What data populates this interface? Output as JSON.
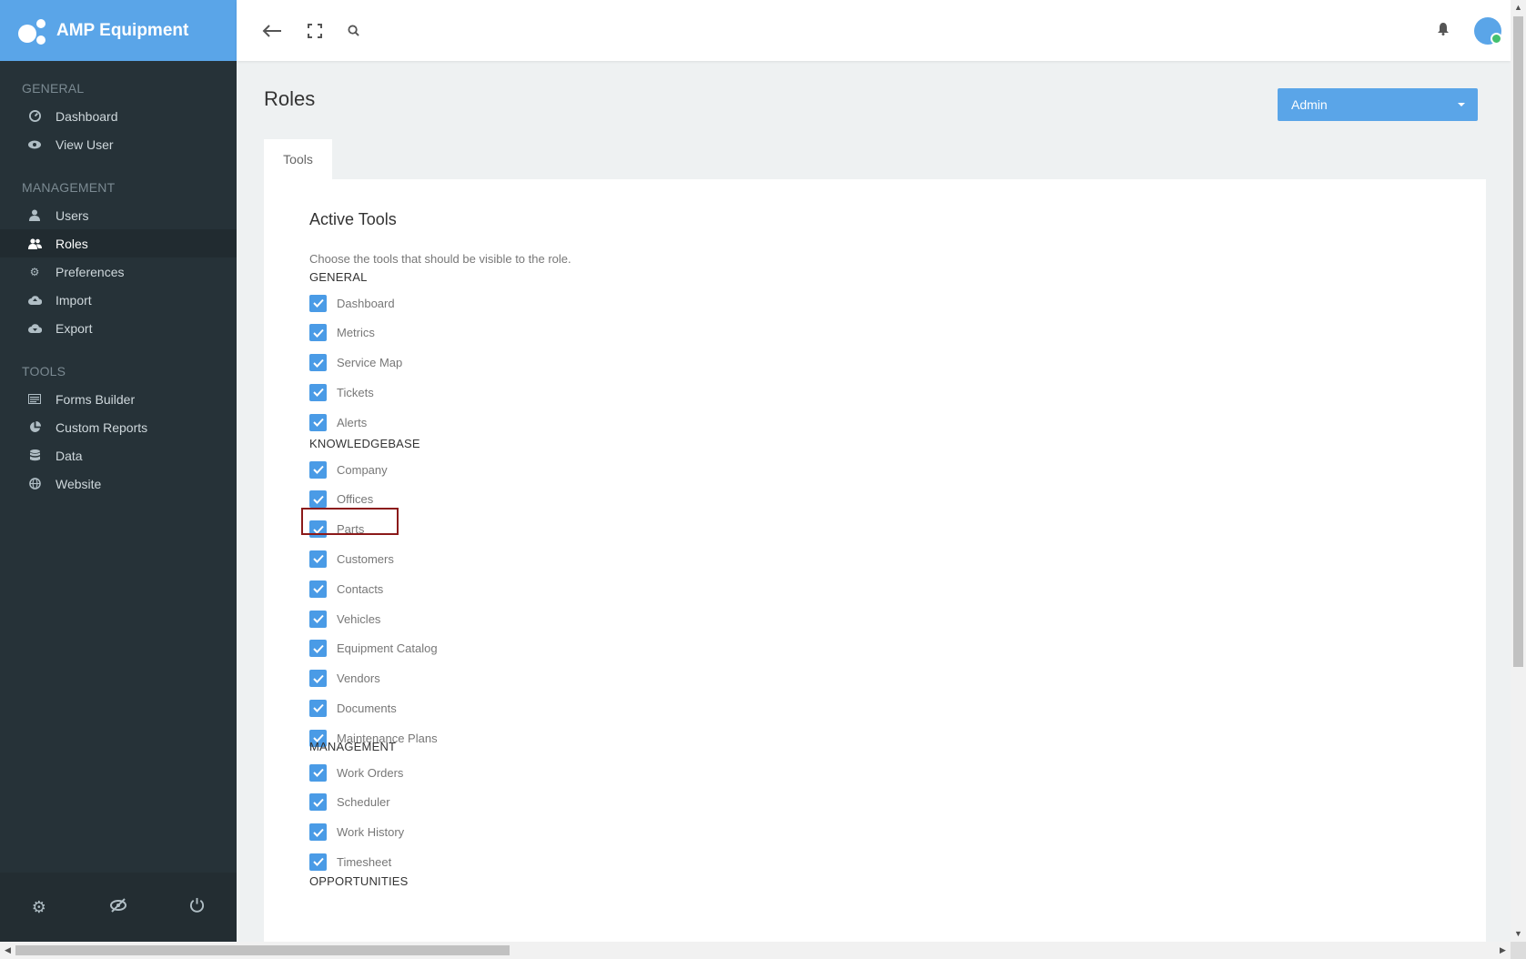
{
  "brand": {
    "name": "AMP Equipment"
  },
  "sidebar": {
    "sections": [
      {
        "title": "GENERAL",
        "items": [
          {
            "label": "Dashboard",
            "icon": "dashboard-icon"
          },
          {
            "label": "View User",
            "icon": "eye-icon"
          }
        ]
      },
      {
        "title": "MANAGEMENT",
        "items": [
          {
            "label": "Users",
            "icon": "user-icon"
          },
          {
            "label": "Roles",
            "icon": "users-icon",
            "active": true
          },
          {
            "label": "Preferences",
            "icon": "gear-icon"
          },
          {
            "label": "Import",
            "icon": "cloud-upload-icon"
          },
          {
            "label": "Export",
            "icon": "cloud-download-icon"
          }
        ]
      },
      {
        "title": "TOOLS",
        "items": [
          {
            "label": "Forms Builder",
            "icon": "form-icon"
          },
          {
            "label": "Custom Reports",
            "icon": "pie-chart-icon"
          },
          {
            "label": "Data",
            "icon": "database-icon"
          },
          {
            "label": "Website",
            "icon": "globe-icon"
          }
        ]
      }
    ]
  },
  "page": {
    "title": "Roles"
  },
  "role_select": {
    "value": "Admin"
  },
  "tabs": {
    "tools": "Tools"
  },
  "tools": {
    "title": "Active Tools",
    "description": "Choose the tools that should be visible to the role.",
    "groups": [
      {
        "title": "GENERAL",
        "items": [
          "Dashboard",
          "Metrics",
          "Service Map",
          "Tickets",
          "Alerts"
        ]
      },
      {
        "title": "KNOWLEDGEBASE",
        "items": [
          "Company",
          "Offices",
          "Parts",
          "Customers",
          "Contacts",
          "Vehicles",
          "Equipment Catalog",
          "Vendors",
          "Documents",
          "Maintenance Plans"
        ]
      },
      {
        "title": "MANAGEMENT",
        "items": [
          "Work Orders",
          "Scheduler",
          "Work History",
          "Timesheet"
        ]
      },
      {
        "title": "OPPORTUNITIES",
        "items": []
      }
    ]
  },
  "colors": {
    "accent": "#5aa5e8",
    "sidebar_bg": "#263238",
    "checkbox": "#4a9be6",
    "highlight": "#8b1a1a"
  }
}
